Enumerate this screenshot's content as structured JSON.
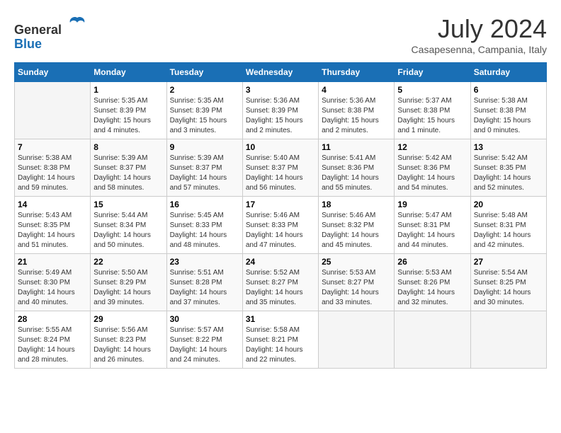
{
  "logo": {
    "line1": "General",
    "line2": "Blue"
  },
  "title": "July 2024",
  "location": "Casapesenna, Campania, Italy",
  "days_of_week": [
    "Sunday",
    "Monday",
    "Tuesday",
    "Wednesday",
    "Thursday",
    "Friday",
    "Saturday"
  ],
  "weeks": [
    [
      {
        "day": "",
        "sunrise": "",
        "sunset": "",
        "daylight": ""
      },
      {
        "day": "1",
        "sunrise": "Sunrise: 5:35 AM",
        "sunset": "Sunset: 8:39 PM",
        "daylight": "Daylight: 15 hours and 4 minutes."
      },
      {
        "day": "2",
        "sunrise": "Sunrise: 5:35 AM",
        "sunset": "Sunset: 8:39 PM",
        "daylight": "Daylight: 15 hours and 3 minutes."
      },
      {
        "day": "3",
        "sunrise": "Sunrise: 5:36 AM",
        "sunset": "Sunset: 8:39 PM",
        "daylight": "Daylight: 15 hours and 2 minutes."
      },
      {
        "day": "4",
        "sunrise": "Sunrise: 5:36 AM",
        "sunset": "Sunset: 8:38 PM",
        "daylight": "Daylight: 15 hours and 2 minutes."
      },
      {
        "day": "5",
        "sunrise": "Sunrise: 5:37 AM",
        "sunset": "Sunset: 8:38 PM",
        "daylight": "Daylight: 15 hours and 1 minute."
      },
      {
        "day": "6",
        "sunrise": "Sunrise: 5:38 AM",
        "sunset": "Sunset: 8:38 PM",
        "daylight": "Daylight: 15 hours and 0 minutes."
      }
    ],
    [
      {
        "day": "7",
        "sunrise": "Sunrise: 5:38 AM",
        "sunset": "Sunset: 8:38 PM",
        "daylight": "Daylight: 14 hours and 59 minutes."
      },
      {
        "day": "8",
        "sunrise": "Sunrise: 5:39 AM",
        "sunset": "Sunset: 8:37 PM",
        "daylight": "Daylight: 14 hours and 58 minutes."
      },
      {
        "day": "9",
        "sunrise": "Sunrise: 5:39 AM",
        "sunset": "Sunset: 8:37 PM",
        "daylight": "Daylight: 14 hours and 57 minutes."
      },
      {
        "day": "10",
        "sunrise": "Sunrise: 5:40 AM",
        "sunset": "Sunset: 8:37 PM",
        "daylight": "Daylight: 14 hours and 56 minutes."
      },
      {
        "day": "11",
        "sunrise": "Sunrise: 5:41 AM",
        "sunset": "Sunset: 8:36 PM",
        "daylight": "Daylight: 14 hours and 55 minutes."
      },
      {
        "day": "12",
        "sunrise": "Sunrise: 5:42 AM",
        "sunset": "Sunset: 8:36 PM",
        "daylight": "Daylight: 14 hours and 54 minutes."
      },
      {
        "day": "13",
        "sunrise": "Sunrise: 5:42 AM",
        "sunset": "Sunset: 8:35 PM",
        "daylight": "Daylight: 14 hours and 52 minutes."
      }
    ],
    [
      {
        "day": "14",
        "sunrise": "Sunrise: 5:43 AM",
        "sunset": "Sunset: 8:35 PM",
        "daylight": "Daylight: 14 hours and 51 minutes."
      },
      {
        "day": "15",
        "sunrise": "Sunrise: 5:44 AM",
        "sunset": "Sunset: 8:34 PM",
        "daylight": "Daylight: 14 hours and 50 minutes."
      },
      {
        "day": "16",
        "sunrise": "Sunrise: 5:45 AM",
        "sunset": "Sunset: 8:33 PM",
        "daylight": "Daylight: 14 hours and 48 minutes."
      },
      {
        "day": "17",
        "sunrise": "Sunrise: 5:46 AM",
        "sunset": "Sunset: 8:33 PM",
        "daylight": "Daylight: 14 hours and 47 minutes."
      },
      {
        "day": "18",
        "sunrise": "Sunrise: 5:46 AM",
        "sunset": "Sunset: 8:32 PM",
        "daylight": "Daylight: 14 hours and 45 minutes."
      },
      {
        "day": "19",
        "sunrise": "Sunrise: 5:47 AM",
        "sunset": "Sunset: 8:31 PM",
        "daylight": "Daylight: 14 hours and 44 minutes."
      },
      {
        "day": "20",
        "sunrise": "Sunrise: 5:48 AM",
        "sunset": "Sunset: 8:31 PM",
        "daylight": "Daylight: 14 hours and 42 minutes."
      }
    ],
    [
      {
        "day": "21",
        "sunrise": "Sunrise: 5:49 AM",
        "sunset": "Sunset: 8:30 PM",
        "daylight": "Daylight: 14 hours and 40 minutes."
      },
      {
        "day": "22",
        "sunrise": "Sunrise: 5:50 AM",
        "sunset": "Sunset: 8:29 PM",
        "daylight": "Daylight: 14 hours and 39 minutes."
      },
      {
        "day": "23",
        "sunrise": "Sunrise: 5:51 AM",
        "sunset": "Sunset: 8:28 PM",
        "daylight": "Daylight: 14 hours and 37 minutes."
      },
      {
        "day": "24",
        "sunrise": "Sunrise: 5:52 AM",
        "sunset": "Sunset: 8:27 PM",
        "daylight": "Daylight: 14 hours and 35 minutes."
      },
      {
        "day": "25",
        "sunrise": "Sunrise: 5:53 AM",
        "sunset": "Sunset: 8:27 PM",
        "daylight": "Daylight: 14 hours and 33 minutes."
      },
      {
        "day": "26",
        "sunrise": "Sunrise: 5:53 AM",
        "sunset": "Sunset: 8:26 PM",
        "daylight": "Daylight: 14 hours and 32 minutes."
      },
      {
        "day": "27",
        "sunrise": "Sunrise: 5:54 AM",
        "sunset": "Sunset: 8:25 PM",
        "daylight": "Daylight: 14 hours and 30 minutes."
      }
    ],
    [
      {
        "day": "28",
        "sunrise": "Sunrise: 5:55 AM",
        "sunset": "Sunset: 8:24 PM",
        "daylight": "Daylight: 14 hours and 28 minutes."
      },
      {
        "day": "29",
        "sunrise": "Sunrise: 5:56 AM",
        "sunset": "Sunset: 8:23 PM",
        "daylight": "Daylight: 14 hours and 26 minutes."
      },
      {
        "day": "30",
        "sunrise": "Sunrise: 5:57 AM",
        "sunset": "Sunset: 8:22 PM",
        "daylight": "Daylight: 14 hours and 24 minutes."
      },
      {
        "day": "31",
        "sunrise": "Sunrise: 5:58 AM",
        "sunset": "Sunset: 8:21 PM",
        "daylight": "Daylight: 14 hours and 22 minutes."
      },
      {
        "day": "",
        "sunrise": "",
        "sunset": "",
        "daylight": ""
      },
      {
        "day": "",
        "sunrise": "",
        "sunset": "",
        "daylight": ""
      },
      {
        "day": "",
        "sunrise": "",
        "sunset": "",
        "daylight": ""
      }
    ]
  ]
}
